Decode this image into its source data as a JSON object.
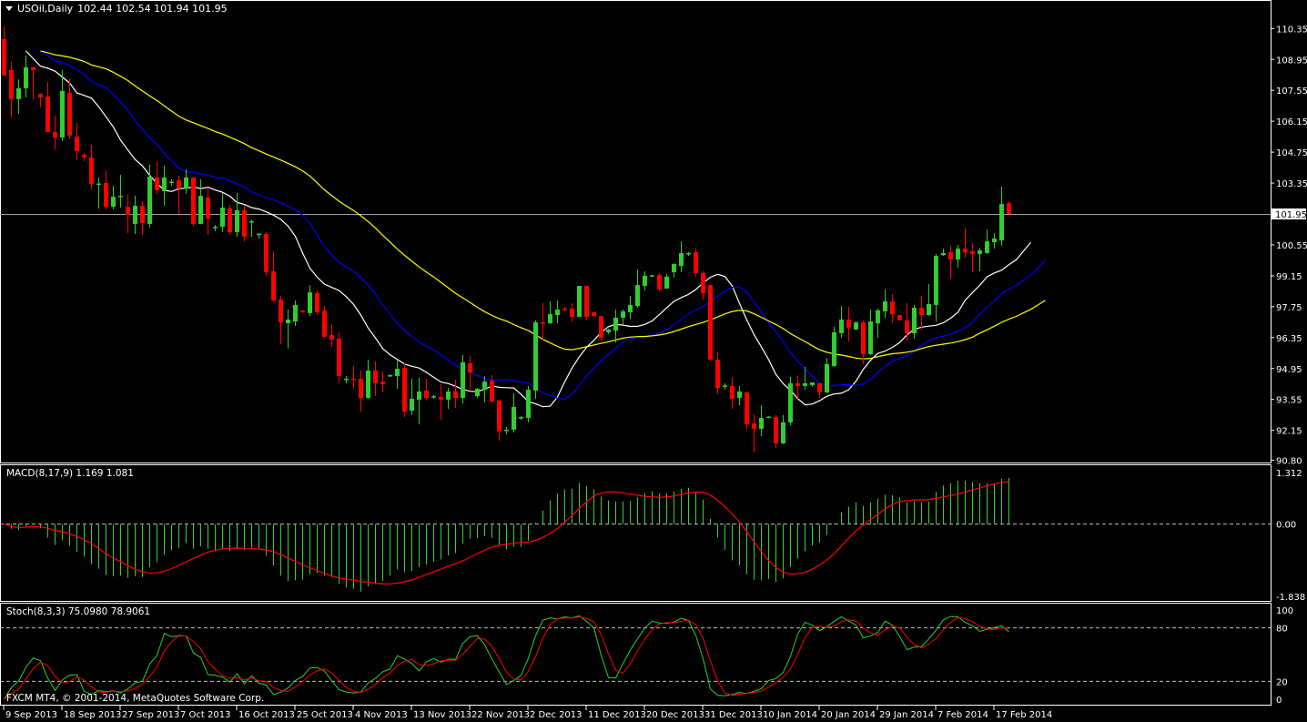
{
  "header": {
    "symbol": "USOil,Daily",
    "ohlc": "102.44 102.54 101.94 101.95"
  },
  "macd_label": {
    "name": "MACD(8,17,9)",
    "values": "1.169 1.081"
  },
  "stoch_label": {
    "name": "Stoch(8,3,3)",
    "values": "75.0980 78.9061"
  },
  "copyright": "FXCM MT4, © 2001-2014, MetaQuotes Software Corp.",
  "colors": {
    "bull": "#32cd32",
    "bear": "#ff0000",
    "ma_fast": "#ffffff",
    "ma_mid": "#0000ff",
    "ma_slow": "#ffff00",
    "macd_hist": "#3ccf3c",
    "signal": "#ff0000",
    "stoch_main": "#32cd32",
    "stoch_signal": "#ff0000",
    "grid": "#c0c0c0"
  },
  "chart_data": {
    "type": "candlestick",
    "title": "USOil,Daily",
    "timeframe": "Daily",
    "current_price": "101.95",
    "price_ticks": [
      "110.35",
      "108.95",
      "107.55",
      "106.15",
      "104.75",
      "103.35",
      "100.55",
      "99.15",
      "97.75",
      "96.35",
      "94.95",
      "93.55",
      "92.15",
      "90.80"
    ],
    "ylim": [
      90.8,
      110.35
    ],
    "date_labels": [
      "9 Sep 2013",
      "18 Sep 2013",
      "27 Sep 2013",
      "7 Oct 2013",
      "16 Oct 2013",
      "25 Oct 2013",
      "4 Nov 2013",
      "13 Nov 2013",
      "22 Nov 2013",
      "2 Dec 2013",
      "11 Dec 2013",
      "20 Dec 2013",
      "31 Dec 2013",
      "10 Jan 2014",
      "20 Jan 2014",
      "29 Jan 2014",
      "7 Feb 2014",
      "17 Feb 2014"
    ],
    "date_label_every_bars": 8,
    "overlays": [
      {
        "name": "ma-fast",
        "period": 5,
        "shift": 3,
        "color": "#ffffff"
      },
      {
        "name": "ma-mid",
        "period": 8,
        "shift": 5,
        "color": "#0000ff"
      },
      {
        "name": "ma-slow",
        "period": 21,
        "shift": 5,
        "color": "#ffff00"
      }
    ],
    "ohlc": [
      [
        109.87,
        110.45,
        108.22,
        108.22
      ],
      [
        108.47,
        108.84,
        106.32,
        107.15
      ],
      [
        107.15,
        108.05,
        106.49,
        107.64
      ],
      [
        107.64,
        109.13,
        107.23,
        108.59
      ],
      [
        108.59,
        108.63,
        107.15,
        108.47
      ],
      [
        107.39,
        107.39,
        106.78,
        107.23
      ],
      [
        107.27,
        107.93,
        105.66,
        105.66
      ],
      [
        105.66,
        106.4,
        104.88,
        105.41
      ],
      [
        105.41,
        108.47,
        105.25,
        107.52
      ],
      [
        107.44,
        108.1,
        105.33,
        105.5
      ],
      [
        105.46,
        106.07,
        104.42,
        104.8
      ],
      [
        104.63,
        104.71,
        104.34,
        104.51
      ],
      [
        104.51,
        105.08,
        103.06,
        103.31
      ],
      [
        103.31,
        103.6,
        102.2,
        103.33
      ],
      [
        103.35,
        103.93,
        102.16,
        102.28
      ],
      [
        102.28,
        103.23,
        102.16,
        102.73
      ],
      [
        102.73,
        103.72,
        102.24,
        102.77
      ],
      [
        102.28,
        102.82,
        101.08,
        101.91
      ],
      [
        101.5,
        102.77,
        101.04,
        102.32
      ],
      [
        102.32,
        102.53,
        101.0,
        101.54
      ],
      [
        101.5,
        104.18,
        101.33,
        103.64
      ],
      [
        103.6,
        104.34,
        102.86,
        103.02
      ],
      [
        102.98,
        104.14,
        102.32,
        103.6
      ],
      [
        103.39,
        103.52,
        103.23,
        103.41
      ],
      [
        103.48,
        103.68,
        101.95,
        103.1
      ],
      [
        103.1,
        103.97,
        102.86,
        103.6
      ],
      [
        103.6,
        103.64,
        101.41,
        101.5
      ],
      [
        101.5,
        103.52,
        101.5,
        102.77
      ],
      [
        102.69,
        103.15,
        101.0,
        101.74
      ],
      [
        101.33,
        101.45,
        101.17,
        101.37
      ],
      [
        101.37,
        102.9,
        101.13,
        102.24
      ],
      [
        102.2,
        102.36,
        101.0,
        101.13
      ],
      [
        101.13,
        102.9,
        100.92,
        102.12
      ],
      [
        102.12,
        102.36,
        100.71,
        100.92
      ],
      [
        101.62,
        101.7,
        100.92,
        101.62
      ],
      [
        101.04,
        101.08,
        100.84,
        101.06
      ],
      [
        101.04,
        101.13,
        99.15,
        99.31
      ],
      [
        99.35,
        100.26,
        97.95,
        98.03
      ],
      [
        98.07,
        98.24,
        96.05,
        97.04
      ],
      [
        97.0,
        97.62,
        95.85,
        97.17
      ],
      [
        97.08,
        98.03,
        96.88,
        97.83
      ],
      [
        97.58,
        97.58,
        97.46,
        97.5
      ],
      [
        97.46,
        98.73,
        97.33,
        98.4
      ],
      [
        98.36,
        98.49,
        97.37,
        97.5
      ],
      [
        97.58,
        97.78,
        96.38,
        96.38
      ],
      [
        96.47,
        96.96,
        95.93,
        96.26
      ],
      [
        96.3,
        96.59,
        94.28,
        94.61
      ],
      [
        94.44,
        94.61,
        94.28,
        94.49
      ],
      [
        94.49,
        95.06,
        94.03,
        94.44
      ],
      [
        94.49,
        94.86,
        93.0,
        93.62
      ],
      [
        93.62,
        95.35,
        93.58,
        94.86
      ],
      [
        94.86,
        95.27,
        93.7,
        94.28
      ],
      [
        94.36,
        94.82,
        93.87,
        94.24
      ],
      [
        94.61,
        94.69,
        94.57,
        94.65
      ],
      [
        94.61,
        95.31,
        94.03,
        94.94
      ],
      [
        94.98,
        95.19,
        92.75,
        93.0
      ],
      [
        93.04,
        94.49,
        92.84,
        93.58
      ],
      [
        93.54,
        94.53,
        92.42,
        93.91
      ],
      [
        93.95,
        94.49,
        93.5,
        93.62
      ],
      [
        93.66,
        93.74,
        93.58,
        93.7
      ],
      [
        93.66,
        94.24,
        92.63,
        93.54
      ],
      [
        93.54,
        94.07,
        93.12,
        93.91
      ],
      [
        93.91,
        94.44,
        93.17,
        93.62
      ],
      [
        93.62,
        95.56,
        93.37,
        95.23
      ],
      [
        95.19,
        95.52,
        93.99,
        94.77
      ],
      [
        93.7,
        94.07,
        93.62,
        94.03
      ],
      [
        93.99,
        94.61,
        93.41,
        94.36
      ],
      [
        94.4,
        94.65,
        93.41,
        93.45
      ],
      [
        93.5,
        93.54,
        91.68,
        92.1
      ],
      [
        92.18,
        92.3,
        91.97,
        92.18
      ],
      [
        92.18,
        93.83,
        92.05,
        93.21
      ],
      [
        92.75,
        92.79,
        92.63,
        92.75
      ],
      [
        92.71,
        94.16,
        92.51,
        93.99
      ],
      [
        93.95,
        97.13,
        93.58,
        97.04
      ],
      [
        97.04,
        97.91,
        96.22,
        97.0
      ],
      [
        97.0,
        97.99,
        96.96,
        97.41
      ],
      [
        97.37,
        98.03,
        97.0,
        97.62
      ],
      [
        97.66,
        97.74,
        97.54,
        97.62
      ],
      [
        97.66,
        97.91,
        97.08,
        97.29
      ],
      [
        97.29,
        98.69,
        97.29,
        98.69
      ],
      [
        98.69,
        98.69,
        97.13,
        97.29
      ],
      [
        97.5,
        97.5,
        97.29,
        97.33
      ],
      [
        97.33,
        97.33,
        96.18,
        96.34
      ],
      [
        96.59,
        96.75,
        96.51,
        96.71
      ],
      [
        96.67,
        97.62,
        96.13,
        97.25
      ],
      [
        97.25,
        97.62,
        96.96,
        97.54
      ],
      [
        97.5,
        98.24,
        97.21,
        97.83
      ],
      [
        97.78,
        99.43,
        97.7,
        98.73
      ],
      [
        98.69,
        99.35,
        98.49,
        99.15
      ],
      [
        99.15,
        99.19,
        99.11,
        99.17
      ],
      [
        99.19,
        99.27,
        98.44,
        98.53
      ],
      [
        98.57,
        99.23,
        98.57,
        99.11
      ],
      [
        99.31,
        99.72,
        99.06,
        99.68
      ],
      [
        99.6,
        100.71,
        99.31,
        100.18
      ],
      [
        100.14,
        100.22,
        100.05,
        100.18
      ],
      [
        100.22,
        100.38,
        99.11,
        99.27
      ],
      [
        99.27,
        99.35,
        98.07,
        98.36
      ],
      [
        98.73,
        98.73,
        95.27,
        95.35
      ],
      [
        95.35,
        95.68,
        93.79,
        94.07
      ],
      [
        94.16,
        94.28,
        93.99,
        94.18
      ],
      [
        94.16,
        94.53,
        93.12,
        93.58
      ],
      [
        93.62,
        94.16,
        93.29,
        93.91
      ],
      [
        93.87,
        93.87,
        92.18,
        92.42
      ],
      [
        92.46,
        92.88,
        91.15,
        92.22
      ],
      [
        92.22,
        93.29,
        91.89,
        92.71
      ],
      [
        92.75,
        92.79,
        92.71,
        92.77
      ],
      [
        92.75,
        92.84,
        91.35,
        91.56
      ],
      [
        91.56,
        92.84,
        91.52,
        92.51
      ],
      [
        92.51,
        94.57,
        92.38,
        94.28
      ],
      [
        94.28,
        94.61,
        93.58,
        94.16
      ],
      [
        94.16,
        95.02,
        93.99,
        94.28
      ],
      [
        94.2,
        94.32,
        94.12,
        94.32
      ],
      [
        94.28,
        94.28,
        93.62,
        93.87
      ],
      [
        93.87,
        95.43,
        93.83,
        95.15
      ],
      [
        95.06,
        96.84,
        95.02,
        96.59
      ],
      [
        96.55,
        97.78,
        96.34,
        97.17
      ],
      [
        97.17,
        97.74,
        96.18,
        96.8
      ],
      [
        96.71,
        97.08,
        96.71,
        97.04
      ],
      [
        97.04,
        97.13,
        95.15,
        95.6
      ],
      [
        95.6,
        97.62,
        95.56,
        97.08
      ],
      [
        97.0,
        97.66,
        96.34,
        97.58
      ],
      [
        97.54,
        98.53,
        97.25,
        97.99
      ],
      [
        97.99,
        98.32,
        97.04,
        97.41
      ],
      [
        97.37,
        97.37,
        97.13,
        97.13
      ],
      [
        97.13,
        97.91,
        96.18,
        96.55
      ],
      [
        96.55,
        97.83,
        96.3,
        97.7
      ],
      [
        97.7,
        98.24,
        96.71,
        97.37
      ],
      [
        97.37,
        98.77,
        97.33,
        97.87
      ],
      [
        97.83,
        100.14,
        97.08,
        100.05
      ],
      [
        100.09,
        100.38,
        100.05,
        100.18
      ],
      [
        100.22,
        100.51,
        99.02,
        99.89
      ],
      [
        99.89,
        100.55,
        99.52,
        100.38
      ],
      [
        100.38,
        101.33,
        99.97,
        100.22
      ],
      [
        100.26,
        100.63,
        99.31,
        100.14
      ],
      [
        100.14,
        100.42,
        99.35,
        100.3
      ],
      [
        100.18,
        101.25,
        100.14,
        100.71
      ],
      [
        100.67,
        101.08,
        100.38,
        100.84
      ],
      [
        100.75,
        103.19,
        100.51,
        102.4
      ],
      [
        102.44,
        102.54,
        101.94,
        101.95
      ]
    ],
    "macd": {
      "fast": 8,
      "slow": 17,
      "signal": 9,
      "ticks": [
        "1.312",
        "0.00",
        "-1.838"
      ],
      "ylim": [
        -1.838,
        1.312
      ],
      "last_main": 1.169,
      "last_signal": 1.081
    },
    "stoch": {
      "k": 8,
      "d": 3,
      "slowing": 3,
      "ticks": [
        "100",
        "80",
        "20",
        "0"
      ],
      "levels": [
        80,
        20
      ],
      "ylim": [
        0,
        100
      ],
      "last_main": 75.098,
      "last_signal": 78.9061
    }
  }
}
